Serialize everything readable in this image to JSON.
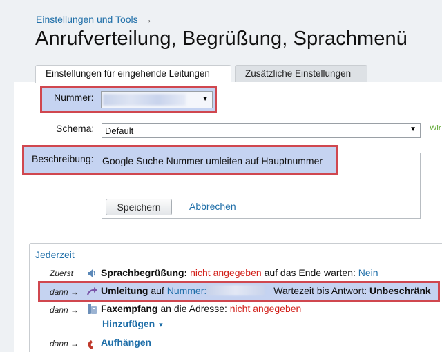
{
  "breadcrumb": {
    "link": "Einstellungen und Tools",
    "arrow": "→"
  },
  "page_title": "Anrufverteilung, Begrüßung, Sprachmenü",
  "tabs": [
    {
      "label": "Einstellungen für eingehende Leitungen",
      "active": true
    },
    {
      "label": "Zusätzliche Einstellungen",
      "active": false
    }
  ],
  "form": {
    "number_label": "Nummer:",
    "schema_label": "Schema:",
    "schema_value": "Default",
    "schema_hint": "Wir",
    "description_label": "Beschreibung:",
    "description_value": "Google Suche Nummer umleiten auf Hauptnummer",
    "save_label": "Speichern",
    "cancel_label": "Abbrechen"
  },
  "rules": {
    "section_title": "Jederzeit",
    "items": [
      {
        "step": "Zuerst",
        "title": "Sprachbegrüßung:",
        "status": "nicht angegeben",
        "text": "auf das Ende warten:",
        "value": "Nein"
      },
      {
        "step": "dann →",
        "title": "Umleitung",
        "text": "auf",
        "link": "Nummer:",
        "wait_label": "Wartezeit bis Antwort:",
        "wait_value": "Unbeschränk"
      },
      {
        "step": "dann →",
        "title": "Faxempfang",
        "text": "an die Adresse:",
        "status": "nicht angegeben"
      },
      {
        "step": "dann →",
        "title": "Aufhängen"
      }
    ],
    "add_label": "Hinzufügen",
    "add_arrow": "▾"
  },
  "colors": {
    "link": "#1e6ea8",
    "highlight_border": "#d0474f",
    "highlight_fill": "#96afe6",
    "warning": "#d2201a",
    "hint": "#5ea830"
  }
}
